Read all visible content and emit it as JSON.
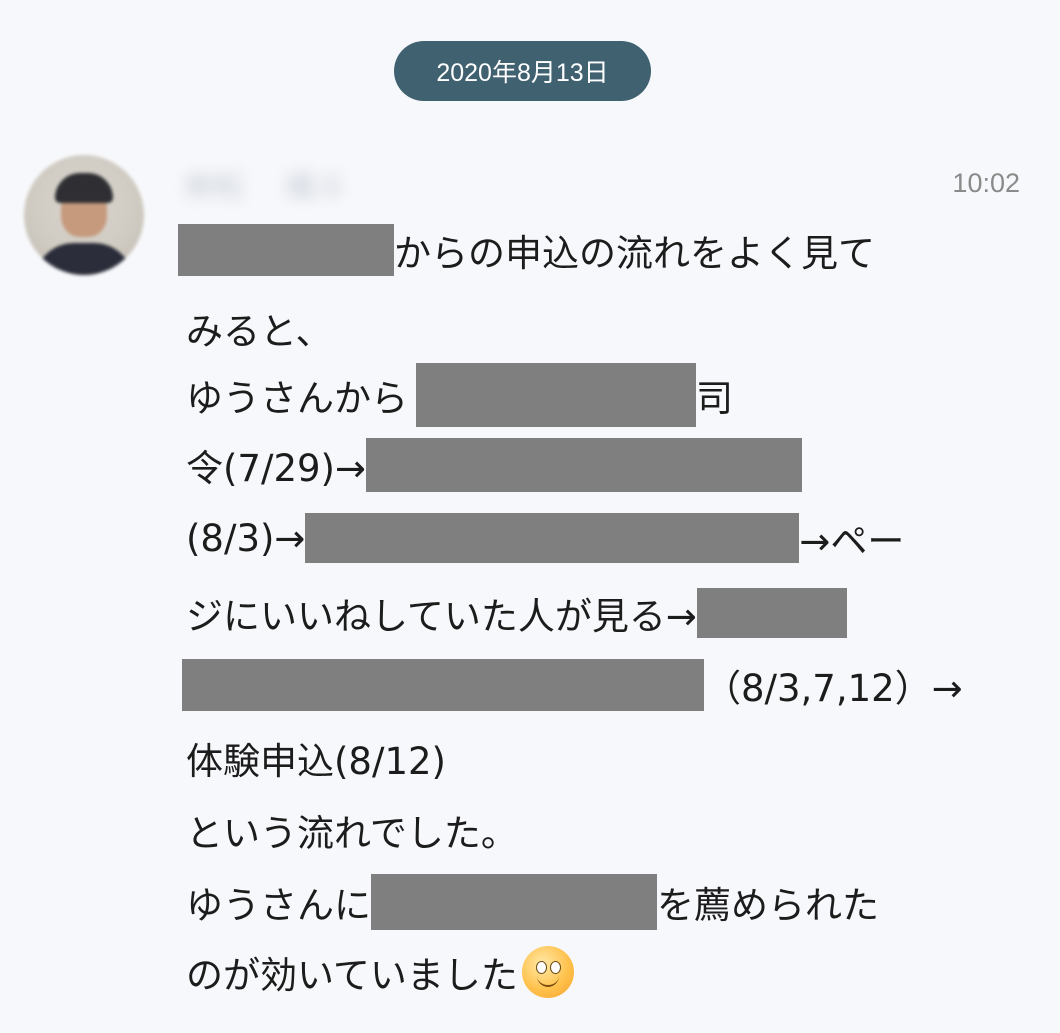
{
  "date_separator": "2020年8月13日",
  "message": {
    "sender_name_blurred": [
      "柳松",
      "颯斗"
    ],
    "time": "10:02",
    "lines": [
      "からの申込の流れをよく見て",
      "みると、",
      "ゆうさんから",
      "司",
      "令(7/29)→",
      "(8/3)→",
      "→ペー",
      "ジにいいねしていた人が見る→",
      "（8/3,7,12）→",
      "体験申込(8/12)",
      "という流れでした。",
      "ゆうさんに",
      "を薦められた",
      "のが効いていました"
    ],
    "emoji": "smiley-face-icon"
  },
  "colors": {
    "date_pill": "#3f6170",
    "background": "#f7f8fb",
    "redaction": "#7f7f7f"
  }
}
